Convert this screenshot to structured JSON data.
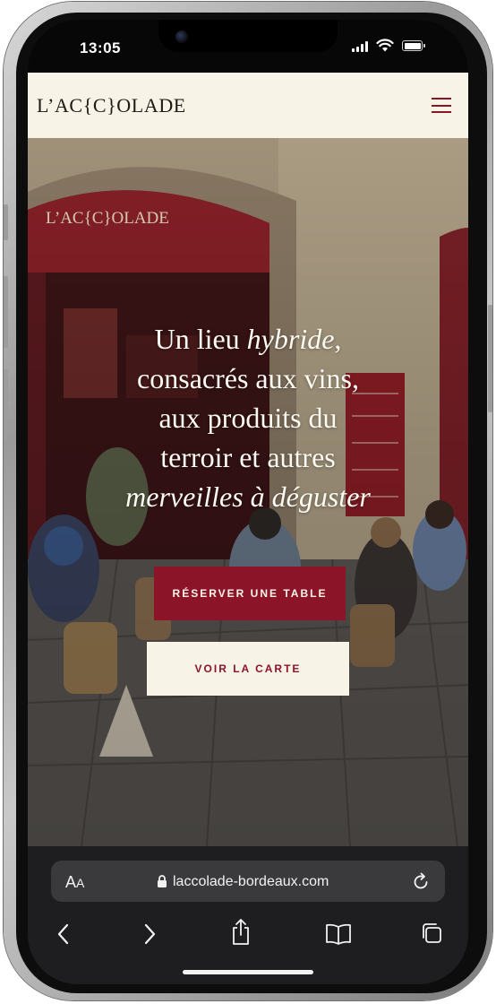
{
  "status_bar": {
    "time": "13:05"
  },
  "site": {
    "logo": "L’AC{C}OLADE"
  },
  "hero": {
    "line1_plain": "Un lieu ",
    "line1_italic": "hybride",
    "line1_end": ",",
    "line2": "consacrés aux vins,",
    "line3": "aux produits du",
    "line4": "terroir et autres",
    "line5_italic": "merveilles à déguster",
    "reserve_button": "RÉSERVER UNE TABLE",
    "menu_button": "VOIR LA CARTE"
  },
  "browser": {
    "text_size_label_large": "A",
    "text_size_label_small": "A",
    "url": "laccolade-bordeaux.com"
  },
  "colors": {
    "brand_red": "#8c1428",
    "cream": "#f7f3e6"
  }
}
